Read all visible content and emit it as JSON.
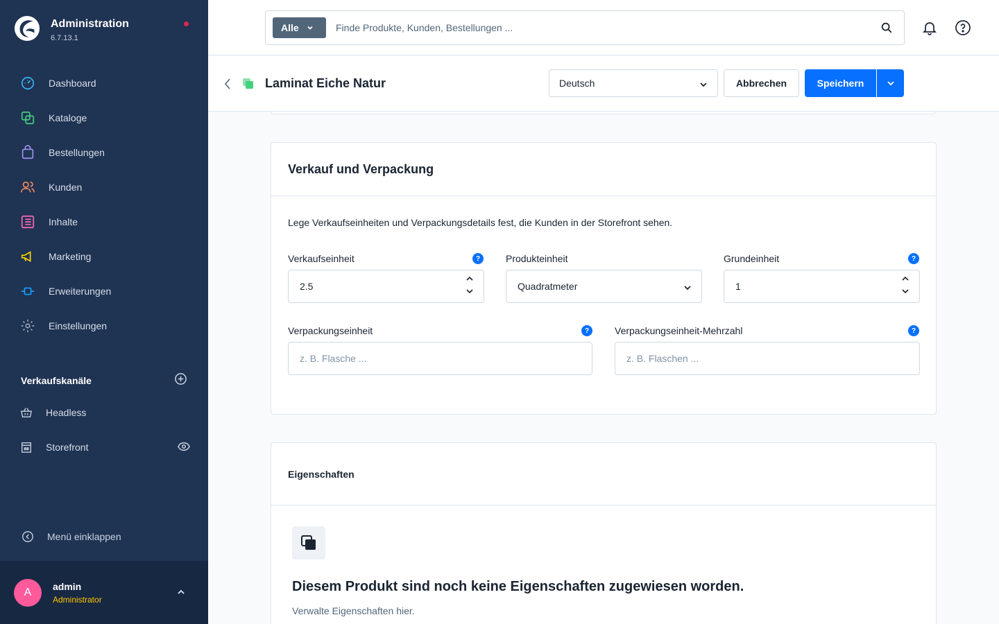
{
  "brand": {
    "title": "Administration",
    "version": "6.7.13.1"
  },
  "nav": {
    "items": [
      {
        "label": "Dashboard",
        "color": "#3ab4f5"
      },
      {
        "label": "Kataloge",
        "color": "#45d07e"
      },
      {
        "label": "Bestellungen",
        "color": "#a092f0"
      },
      {
        "label": "Kunden",
        "color": "#f88962"
      },
      {
        "label": "Inhalte",
        "color": "#ff68b4"
      },
      {
        "label": "Marketing",
        "color": "#ffd700"
      },
      {
        "label": "Erweiterungen",
        "color": "#189eff"
      },
      {
        "label": "Einstellungen",
        "color": "#9aa8b5"
      }
    ]
  },
  "sales_channels": {
    "title": "Verkaufskanäle",
    "items": [
      {
        "label": "Headless"
      },
      {
        "label": "Storefront"
      }
    ]
  },
  "collapse_label": "Menü einklappen",
  "user": {
    "initial": "A",
    "name": "admin",
    "role": "Administrator"
  },
  "search": {
    "type_label": "Alle",
    "placeholder": "Finde Produkte, Kunden, Bestellungen ..."
  },
  "smartbar": {
    "title": "Laminat Eiche Natur",
    "language": "Deutsch",
    "cancel_label": "Abbrechen",
    "save_label": "Speichern"
  },
  "packaging_card": {
    "title": "Verkauf und Verpackung",
    "description": "Lege Verkaufseinheiten und Verpackungsdetails fest, die Kunden in der Storefront sehen.",
    "fields": {
      "purchase_unit": {
        "label": "Verkaufseinheit",
        "value": "2.5"
      },
      "product_unit": {
        "label": "Produkteinheit",
        "value": "Quadratmeter"
      },
      "reference_unit": {
        "label": "Grundeinheit",
        "value": "1"
      },
      "pack_unit": {
        "label": "Verpackungseinheit",
        "placeholder": "z. B. Flasche ..."
      },
      "pack_unit_plural": {
        "label": "Verpackungseinheit-Mehrzahl",
        "placeholder": "z. B. Flaschen ..."
      }
    },
    "help_glyph": "?"
  },
  "properties_card": {
    "title": "Eigenschaften",
    "empty_title": "Diesem Produkt sind noch keine Eigenschaften zugewiesen worden.",
    "empty_sub": "Verwalte Eigenschaften hier."
  },
  "colors": {
    "sidebar": "#1f3353",
    "primary": "#0870ff",
    "avatar": "#ff5a9a",
    "role": "#ffc600"
  }
}
